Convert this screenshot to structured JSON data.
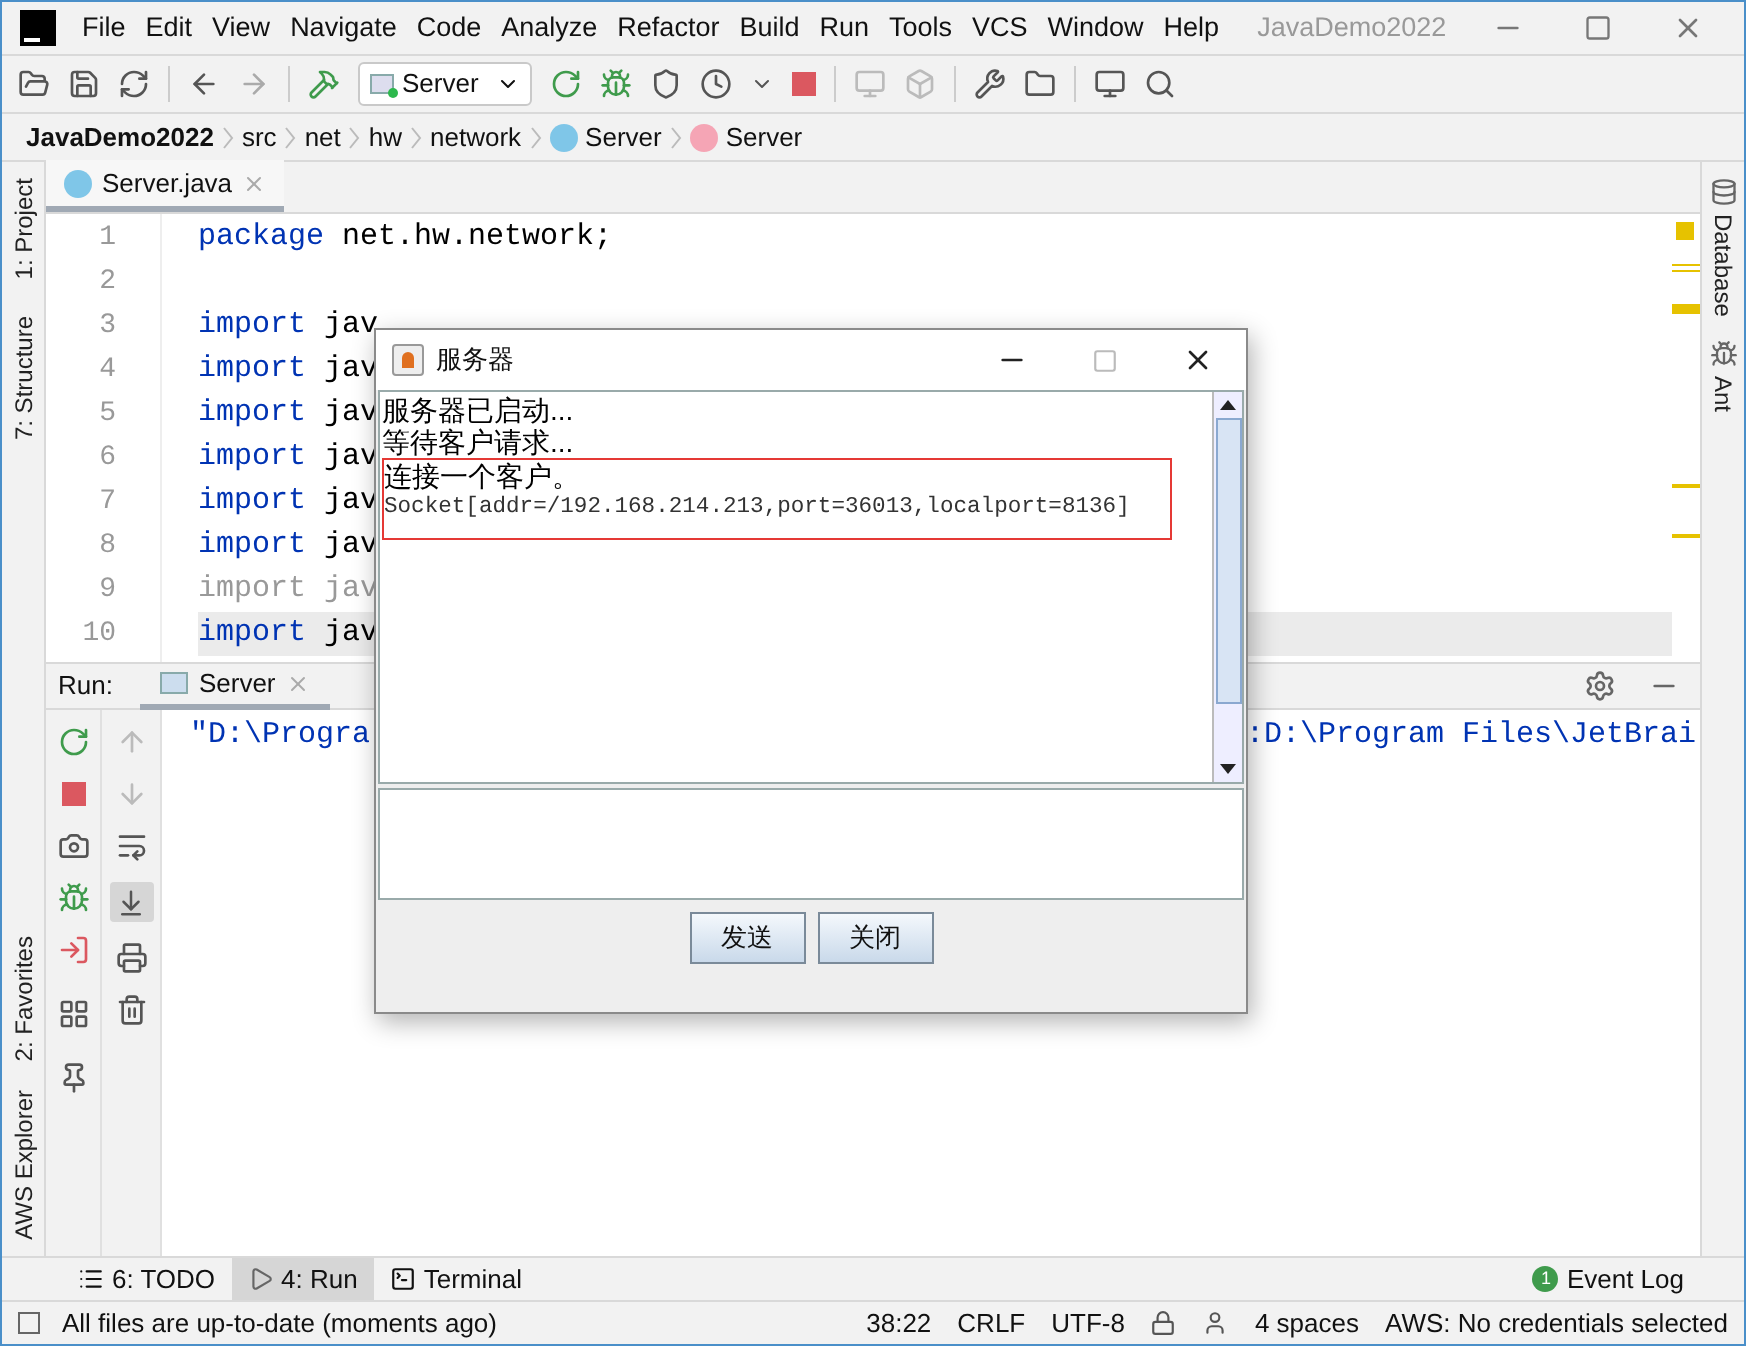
{
  "window": {
    "title": "JavaDemo2022"
  },
  "menu": [
    "File",
    "Edit",
    "View",
    "Navigate",
    "Code",
    "Analyze",
    "Refactor",
    "Build",
    "Run",
    "Tools",
    "VCS",
    "Window",
    "Help"
  ],
  "toolbar": {
    "run_config": "Server"
  },
  "breadcrumb": [
    {
      "label": "JavaDemo2022",
      "kind": "project"
    },
    {
      "label": "src",
      "kind": "folder"
    },
    {
      "label": "net",
      "kind": "folder"
    },
    {
      "label": "hw",
      "kind": "folder"
    },
    {
      "label": "network",
      "kind": "folder"
    },
    {
      "label": "Server",
      "kind": "class"
    },
    {
      "label": "Server",
      "kind": "method"
    }
  ],
  "left_stripe": {
    "top": [
      "1: Project",
      "7: Structure"
    ],
    "bottom": [
      "2: Favorites",
      "AWS Explorer"
    ]
  },
  "right_stripe": [
    "Database",
    "Ant"
  ],
  "editor_tabs": [
    {
      "label": "Server.java",
      "selected": true
    }
  ],
  "editor": {
    "lines": [
      {
        "number": "1",
        "keyword": "package",
        "rest": "net.hw.network;",
        "unused": false,
        "current": false
      },
      {
        "number": "2"
      },
      {
        "number": "3",
        "keyword": "import",
        "rest": "jav",
        "unused": false,
        "current": false
      },
      {
        "number": "4",
        "keyword": "import",
        "rest": "jav",
        "unused": false,
        "current": false
      },
      {
        "number": "5",
        "keyword": "import",
        "rest": "jav",
        "unused": false,
        "current": false
      },
      {
        "number": "6",
        "keyword": "import",
        "rest": "jav",
        "unused": false,
        "current": false
      },
      {
        "number": "7",
        "keyword": "import",
        "rest": "jav",
        "unused": false,
        "current": false
      },
      {
        "number": "8",
        "keyword": "import",
        "rest": "jav",
        "unused": false,
        "current": false
      },
      {
        "number": "9",
        "keyword": "import",
        "rest": "jav",
        "unused": true,
        "current": false
      },
      {
        "number": "10",
        "keyword": "import",
        "rest": "jav",
        "unused": false,
        "current": true
      }
    ]
  },
  "run_panel": {
    "label": "Run:",
    "tabs": [
      {
        "label": "Server",
        "selected": true
      }
    ],
    "console": [
      "\"D:\\Progra",
      ":D:\\Program Files\\JetBrai"
    ]
  },
  "dialog": {
    "title": "服务器",
    "log": [
      {
        "text": "服务器已启动...",
        "kind": "message",
        "highlighted": false
      },
      {
        "text": "等待客户请求...",
        "kind": "message",
        "highlighted": false
      },
      {
        "text": "连接一个客户。",
        "kind": "message",
        "highlighted": true
      },
      {
        "text": "Socket[addr=/192.168.214.213,port=36013,localport=8136]",
        "kind": "socket",
        "highlighted": true
      }
    ],
    "buttons": [
      "发送",
      "关闭"
    ]
  },
  "bottom_tabs": [
    {
      "label": "6: TODO",
      "kind": "todo",
      "selected": false
    },
    {
      "label": "4: Run",
      "kind": "run",
      "selected": true
    },
    {
      "label": "Terminal",
      "kind": "terminal",
      "selected": false
    }
  ],
  "event_log": {
    "label": "Event Log",
    "count": "1"
  },
  "status_bar": {
    "message": "All files are up-to-date (moments ago)",
    "position": "38:22",
    "line_separator": "CRLF",
    "encoding": "UTF-8",
    "indent": "4 spaces",
    "aws": "AWS: No credentials selected"
  }
}
